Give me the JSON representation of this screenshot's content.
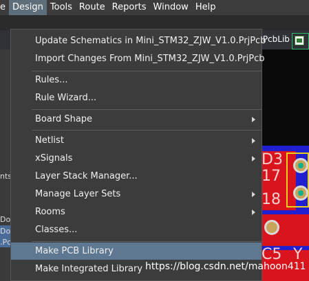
{
  "menubar": {
    "items": [
      {
        "label": "e"
      },
      {
        "label": "Design"
      },
      {
        "label": "Tools"
      },
      {
        "label": "Route"
      },
      {
        "label": "Reports"
      },
      {
        "label": "Window"
      },
      {
        "label": "Help"
      }
    ],
    "active": "Design"
  },
  "doc_tab": {
    "label": ".PcbLib"
  },
  "left_panel": {
    "fragments": [
      "nts",
      "Do",
      "Do",
      ".Pc"
    ]
  },
  "pcb": {
    "labels": [
      "D3",
      "17",
      "18",
      "C5",
      "Y"
    ]
  },
  "design_menu": {
    "items": [
      {
        "label": "Update Schematics in Mini_STM32_ZJW_V1.0.PrjPcb"
      },
      {
        "label": "Import Changes From Mini_STM32_ZJW_V1.0.PrjPcb"
      },
      {
        "label": "Rules..."
      },
      {
        "label": "Rule Wizard..."
      },
      {
        "label": "Board Shape",
        "submenu": true
      },
      {
        "label": "Netlist",
        "submenu": true
      },
      {
        "label": "xSignals",
        "submenu": true
      },
      {
        "label": "Layer Stack Manager..."
      },
      {
        "label": "Manage Layer Sets",
        "submenu": true
      },
      {
        "label": "Rooms",
        "submenu": true
      },
      {
        "label": "Classes..."
      },
      {
        "label": "Make PCB Library",
        "highlighted": true
      },
      {
        "label": "Make Integrated Library"
      }
    ]
  },
  "watermark": "https://blog.csdn.net/mahoon411",
  "colors": {
    "menu_bg": "#3c3c3c",
    "highlight": "#5e7891",
    "pcb_red": "#d8151c",
    "pcb_blue": "#2020d0"
  }
}
